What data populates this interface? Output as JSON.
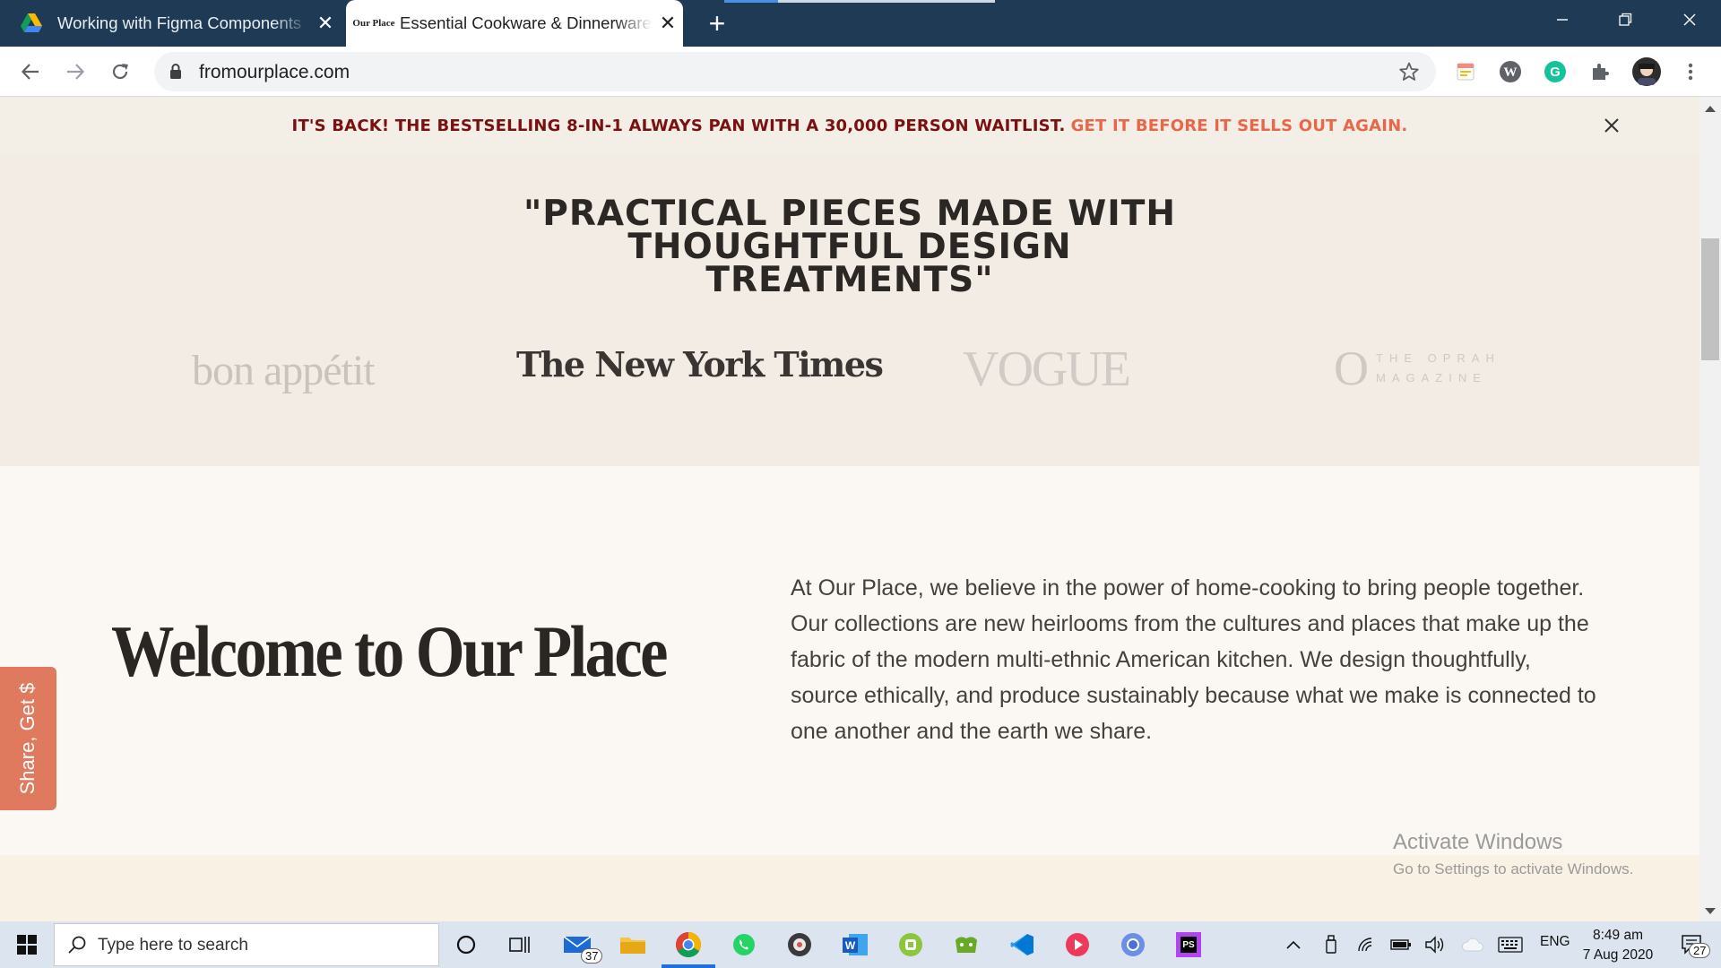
{
  "browser": {
    "tabs": [
      {
        "title": "Working with Figma Components",
        "active": false,
        "favicon": "google-drive-icon"
      },
      {
        "title": "Essential Cookware & Dinnerware",
        "active": true,
        "favicon": "our-place-logo"
      }
    ],
    "favicon_text": "Our Place",
    "address": "fromourplace.com",
    "colors": {
      "tab_strip": "#1e3a54",
      "tab_active": "#ffffff"
    }
  },
  "announcement": {
    "main": "IT'S BACK! THE BESTSELLING 8-IN-1 ALWAYS PAN WITH A 30,000 PERSON WAITLIST.",
    "cta": "GET IT BEFORE IT SELLS OUT AGAIN.",
    "colors": {
      "main": "#7a1010",
      "cta": "#e8664a"
    }
  },
  "press": {
    "quote_line1": "\"PRACTICAL PIECES MADE WITH",
    "quote_line2": "THOUGHTFUL DESIGN",
    "quote_line3": "TREATMENTS\"",
    "logos": {
      "bon_appetit": "bon appétit",
      "nyt": "The New York Times",
      "vogue": "VOGUE",
      "oprah_o": "O",
      "oprah_line1": "THE OPRAH",
      "oprah_line2": "MAGAZINE"
    }
  },
  "welcome": {
    "heading": "Welcome to Our Place",
    "body": "At Our Place, we believe in the power of home-cooking to bring people together. Our collections are new heirlooms from the cultures and places that make up the fabric of the modern multi-ethnic American kitchen. We design thoughtfully, source ethically, and produce sustainably because what we make is connected to one another and the earth we share."
  },
  "share_tab": "Share, Get $",
  "watermark": {
    "title": "Activate Windows",
    "subtitle": "Go to Settings to activate Windows."
  },
  "taskbar": {
    "search_placeholder": "Type here to search",
    "mail_badge": "37",
    "language": "ENG",
    "time": "8:49 am",
    "date": "7 Aug 2020",
    "notifications": "27"
  }
}
